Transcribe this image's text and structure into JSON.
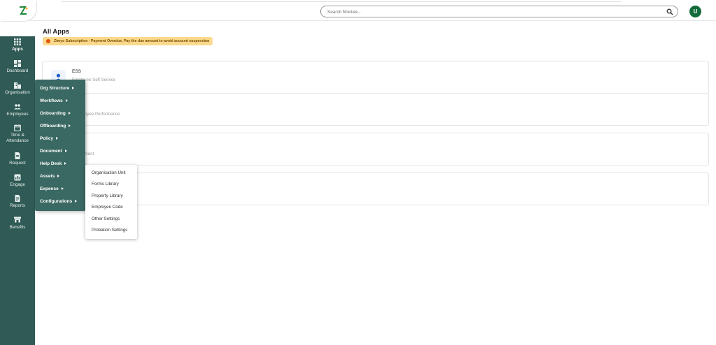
{
  "header": {
    "search_placeholder": "Search Module...",
    "avatar_initial": "U"
  },
  "sidebar": {
    "items": [
      {
        "label": "Apps",
        "icon": "grid-icon"
      },
      {
        "label": "Dashboard",
        "icon": "dashboard-icon"
      },
      {
        "label": "Organisation",
        "icon": "building-icon"
      },
      {
        "label": "Employees",
        "icon": "people-icon"
      },
      {
        "label": "Time &",
        "label2": "Attendance",
        "icon": "calendar-icon"
      },
      {
        "label": "Request",
        "icon": "document-icon"
      },
      {
        "label": "Engage",
        "icon": "chat-icon"
      },
      {
        "label": "Reports",
        "icon": "report-icon"
      },
      {
        "label": "Benefits",
        "icon": "store-icon"
      }
    ]
  },
  "main": {
    "title": "All Apps",
    "alert": "Zimyo Subscription - Payment Overdue, Pay the due amount to avoid account suspension",
    "cards": [
      {
        "title": "ESS",
        "subtitle": "Employee Self Service"
      },
      {
        "title": "mance",
        "subtitle": "r Employee Performance"
      },
      {
        "title": "",
        "subtitle": "ot Payment"
      },
      {
        "title": "",
        "subtitle": ""
      }
    ]
  },
  "menu": {
    "items": [
      "Org Structure",
      "Workflows",
      "Onboarding",
      "Offboarding",
      "Policy",
      "Document",
      "Help Desk",
      "Assets",
      "Expense",
      "Configurations"
    ],
    "submenu": [
      "Organisation Unit",
      "Forms Library",
      "Property Library",
      "Employee Code",
      "Other Settings",
      "Probation Settings"
    ]
  },
  "colors": {
    "sidebar": "#2f5a55",
    "menu": "#3a6862",
    "avatar": "#146b3a",
    "alert_bg": "#fbd98c"
  }
}
